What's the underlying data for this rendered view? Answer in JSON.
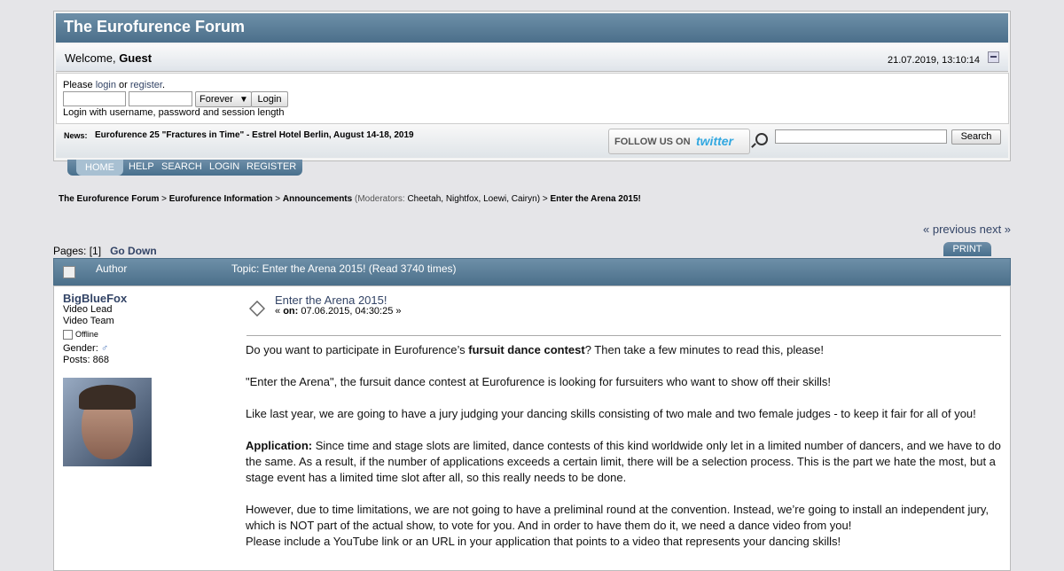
{
  "forum": {
    "title": "The Eurofurence Forum",
    "welcome_prefix": "Welcome,",
    "welcome_user": "Guest",
    "datetime": "21.07.2019, 13:10:14"
  },
  "login": {
    "please": "Please",
    "login": "login",
    "or": "or",
    "register": "register",
    "period": ".",
    "duration": "Forever",
    "button": "Login",
    "hint": "Login with username, password and session length"
  },
  "news": {
    "label": "News:",
    "text": "Eurofurence 25 \"Fractures in Time\" - Estrel Hotel Berlin, August 14-18, 2019"
  },
  "twitter": {
    "follow": "FOLLOW US ON",
    "brand": "twitter"
  },
  "search": {
    "button": "Search"
  },
  "menu": [
    "HOME",
    "HELP",
    "SEARCH",
    "LOGIN",
    "REGISTER"
  ],
  "breadcrumb": {
    "b1": "The Eurofurence Forum",
    "b2": "Eurofurence Information",
    "b3": "Announcements",
    "mods": "(Moderators:",
    "m1": "Cheetah",
    "m2": "Nightfox",
    "m3": "Loewi",
    "m4": "Cairyn",
    "close": ")",
    "b4": "Enter the Arena 2015!",
    "sep": ">"
  },
  "nav": {
    "previous": "« previous",
    "next": "next »",
    "pages": "Pages: [1]",
    "godown": "Go Down",
    "print": "PRINT"
  },
  "topic": {
    "author_label": "Author",
    "title": "Topic: Enter the Arena 2015!  (Read 3740 times)"
  },
  "poster": {
    "name": "BigBlueFox",
    "line1": "Video Lead",
    "line2": "Video Team",
    "status": "Offline",
    "gender": "Gender:",
    "posts": "Posts: 868"
  },
  "post": {
    "title": "Enter the Arena 2015!",
    "date_prefix": "«",
    "on": "on:",
    "date": "07.06.2015, 04:30:25 »"
  },
  "body": {
    "p1a": "Do you want to participate in Eurofurence’s ",
    "p1b": "fursuit dance contest",
    "p1c": "? Then take a few minutes to read this, please!",
    "p2": "\"Enter the Arena\", the fursuit dance contest at Eurofurence is looking for fursuiters who want to show off their skills!",
    "p3": "Like last year, we are going to have a jury judging your dancing skills consisting of two male and two female judges - to keep it fair for all of you!",
    "p4a": "Application:",
    "p4b": " Since time and stage slots are limited, dance contests of this kind worldwide only let in a limited number of dancers, and we have to do the same. As a result, if the number of applications exceeds a certain limit, there will be a selection process. This is the part we hate the most, but a stage event has a limited time slot after all, so this really needs to be done.",
    "p5": "However, due to time limitations, we are not going to have a preliminal round at the convention. Instead, we’re going to install an independent jury, which is NOT part of the actual show, to vote for you. And in order to have them do it, we need a dance video from you!",
    "p6": "Please include a YouTube link or an URL in your application that points to a video that represents your dancing skills!"
  }
}
